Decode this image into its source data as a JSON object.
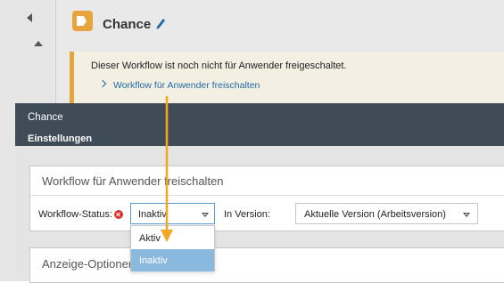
{
  "page": {
    "title": "Chance"
  },
  "notice": {
    "text": "Dieser Workflow ist noch nicht für Anwender freigeschaltet.",
    "link": "Workflow für Anwender freischalten"
  },
  "dialog": {
    "title": "Chance",
    "subtitle": "Einstellungen",
    "panel1": {
      "title": "Workflow für Anwender freischalten",
      "status_label": "Workflow-Status:",
      "status_value": "Inaktiv",
      "version_label": "In Version:",
      "version_value": "Aktuelle Version (Arbeitsversion)"
    },
    "panel2": {
      "title": "Anzeige-Optionen"
    }
  },
  "dropdown": {
    "options": [
      "Aktiv",
      "Inaktiv"
    ],
    "selected": "Inaktiv"
  },
  "colors": {
    "accent": "#e8a43c",
    "header": "#3f4b57",
    "link": "#1e6aa8",
    "selected_option": "#8ab9e0",
    "error": "#d9342b",
    "arrow": "#f5a623"
  },
  "icons": [
    "collapse-left-icon",
    "scroll-up-icon",
    "workflow-logo-icon",
    "pencil-icon",
    "chevron-right-icon",
    "error-icon",
    "caret-down-icon"
  ]
}
